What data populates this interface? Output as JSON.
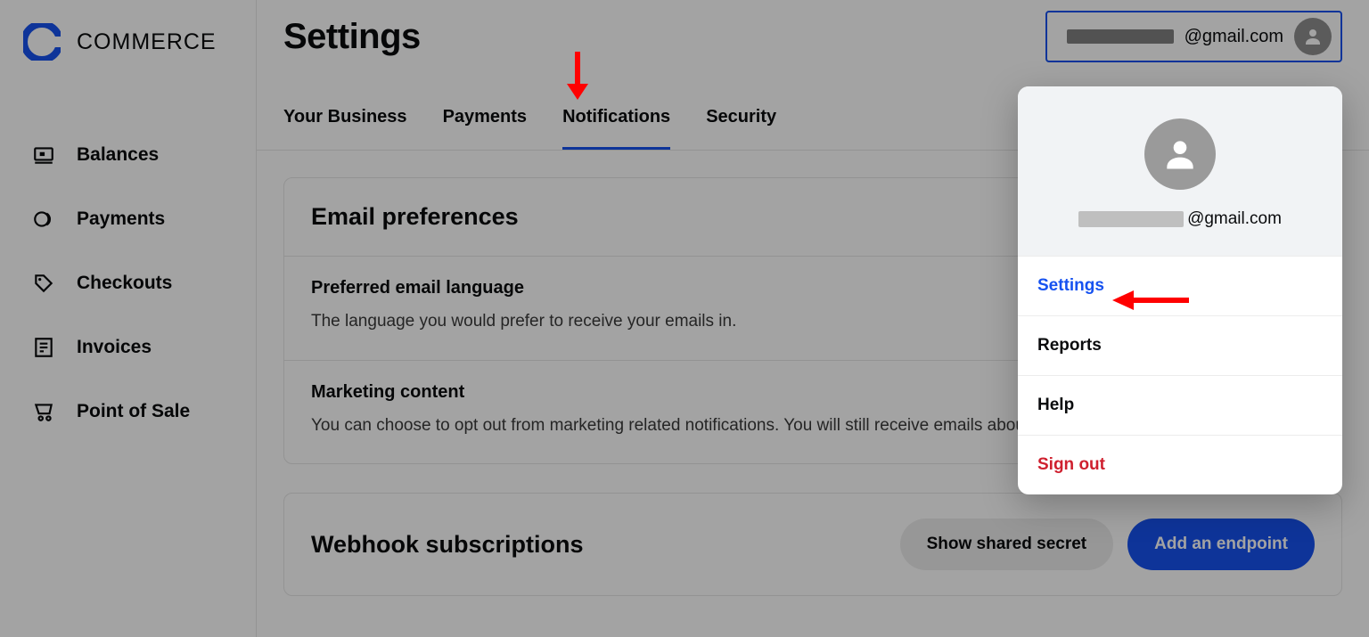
{
  "brand": {
    "name": "COMMERCE"
  },
  "sidebar": {
    "items": [
      {
        "label": "Balances"
      },
      {
        "label": "Payments"
      },
      {
        "label": "Checkouts"
      },
      {
        "label": "Invoices"
      },
      {
        "label": "Point of Sale"
      }
    ]
  },
  "header": {
    "title": "Settings",
    "account_email_suffix": "@gmail.com"
  },
  "tabs": [
    {
      "label": "Your Business",
      "active": false
    },
    {
      "label": "Payments",
      "active": false
    },
    {
      "label": "Notifications",
      "active": true
    },
    {
      "label": "Security",
      "active": false
    }
  ],
  "email_prefs": {
    "title": "Email preferences",
    "rows": [
      {
        "title": "Preferred email language",
        "desc": "The language you would prefer to receive your emails in."
      },
      {
        "title": "Marketing content",
        "desc": "You can choose to opt out from marketing related notifications. You will still receive emails about your transactions and legal updates."
      }
    ]
  },
  "webhooks": {
    "title": "Webhook subscriptions",
    "show_secret": "Show shared secret",
    "add_endpoint": "Add an endpoint"
  },
  "dropdown": {
    "email_suffix": "@gmail.com",
    "items": [
      {
        "label": "Settings",
        "style": "active"
      },
      {
        "label": "Reports",
        "style": "normal"
      },
      {
        "label": "Help",
        "style": "normal"
      },
      {
        "label": "Sign out",
        "style": "danger"
      }
    ]
  }
}
